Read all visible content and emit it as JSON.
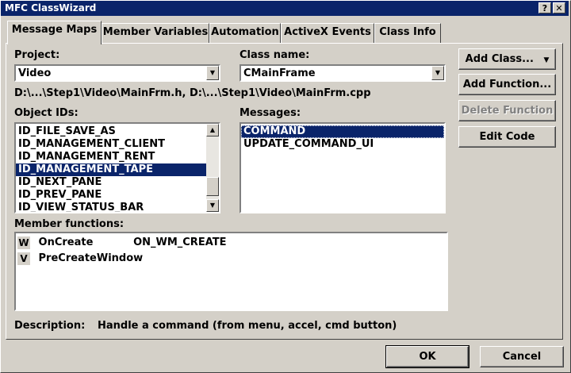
{
  "window": {
    "title": "MFC ClassWizard",
    "help_button": "?",
    "close_button": "X"
  },
  "tabs": [
    {
      "label": "Message Maps",
      "active": true
    },
    {
      "label": "Member Variables",
      "active": false
    },
    {
      "label": "Automation",
      "active": false
    },
    {
      "label": "ActiveX Events",
      "active": false
    },
    {
      "label": "Class Info",
      "active": false
    }
  ],
  "project": {
    "label": "Project:",
    "value": "Video"
  },
  "class_name": {
    "label": "Class name:",
    "value": "CMainFrame"
  },
  "file_path": "D:\\...\\Step1\\Video\\MainFrm.h, D:\\...\\Step1\\Video\\MainFrm.cpp",
  "object_ids": {
    "label": "Object IDs:",
    "items": [
      {
        "text": "ID_FILE_SAVE_AS",
        "selected": false
      },
      {
        "text": "ID_MANAGEMENT_CLIENT",
        "selected": false
      },
      {
        "text": "ID_MANAGEMENT_RENT",
        "selected": false
      },
      {
        "text": "ID_MANAGEMENT_TAPE",
        "selected": true
      },
      {
        "text": "ID_NEXT_PANE",
        "selected": false
      },
      {
        "text": "ID_PREV_PANE",
        "selected": false
      },
      {
        "text": "ID_VIEW_STATUS_BAR",
        "selected": false
      }
    ]
  },
  "messages": {
    "label": "Messages:",
    "items": [
      {
        "text": "COMMAND",
        "selected": true
      },
      {
        "text": "UPDATE_COMMAND_UI",
        "selected": false
      }
    ]
  },
  "member_functions": {
    "label": "Member functions:",
    "items": [
      {
        "type": "W",
        "name": "OnCreate",
        "handler": "ON_WM_CREATE"
      },
      {
        "type": "V",
        "name": "PreCreateWindow",
        "handler": ""
      }
    ]
  },
  "description": {
    "label": "Description:",
    "text": "Handle a command (from menu, accel, cmd button)"
  },
  "buttons": {
    "add_class": "Add Class...",
    "add_function": "Add Function...",
    "delete_function": "Delete Function",
    "edit_code": "Edit Code",
    "ok": "OK",
    "cancel": "Cancel"
  },
  "icons": {
    "dropdown": "triangle-down",
    "scroll_up": "triangle-up",
    "scroll_down": "triangle-down"
  },
  "colors": {
    "titlebar": "#0a246a",
    "selection": "#0a246a",
    "face": "#d4d0c8"
  }
}
